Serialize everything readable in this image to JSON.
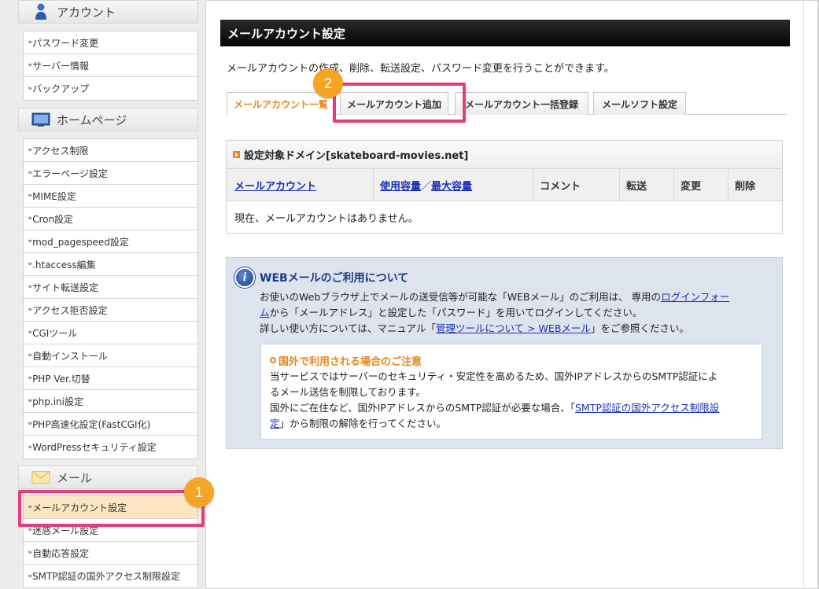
{
  "sidebar": {
    "sections": [
      {
        "heading": "アカウント",
        "icon": "user-icon",
        "items": [
          "パスワード変更",
          "サーバー情報",
          "バックアップ"
        ]
      },
      {
        "heading": "ホームページ",
        "icon": "monitor-icon",
        "items": [
          "アクセス制限",
          "エラーページ設定",
          "MIME設定",
          "Cron設定",
          "mod_pagespeed設定",
          ".htaccess編集",
          "サイト転送設定",
          "アクセス拒否設定",
          "CGIツール",
          "自動インストール",
          "PHP Ver.切替",
          "php.ini設定",
          "PHP高速化設定(FastCGI化)",
          "WordPressセキュリティ設定"
        ]
      },
      {
        "heading": "メール",
        "icon": "envelope-icon",
        "items": [
          "メールアカウント設定",
          "迷惑メール設定",
          "自動応答設定",
          "SMTP認証の国外アクセス制限設定"
        ]
      }
    ],
    "active_item": "メールアカウント設定"
  },
  "main": {
    "title": "メールアカウント設定",
    "description": "メールアカウントの作成、削除、転送設定、パスワード変更を行うことができます。",
    "tabs": [
      "メールアカウント一覧",
      "メールアカウント追加",
      "メールアカウント一括登録",
      "メールソフト設定"
    ],
    "active_tab": "メールアカウント一覧",
    "domain_heading": "設定対象ドメイン[skateboard-movies.net]",
    "table": {
      "col_account": "メールアカウント",
      "col_usage": "使用容量",
      "col_sep": "／",
      "col_max": "最大容量",
      "col_comment": "コメント",
      "col_forward": "転送",
      "col_change": "変更",
      "col_delete": "削除",
      "empty_message": "現在、メールアカウントはありません。"
    },
    "info": {
      "title": "WEBメールのご利用について",
      "line1_a": "お使いのWebブラウザ上でメールの送受信等が可能な「WEBメール」のご利用は、 専用の",
      "line1_link": "ログインフォー",
      "line2_link": "ム",
      "line2_b": "から「メールアドレス」と設定した「パスワード」を用いてログインしてください。",
      "line3_a": "詳しい使い方については、マニュアル「",
      "line3_link": "管理ツールについて > WEBメール",
      "line3_b": "」をご参照ください。",
      "notice_title": "国外で利用される場合のご注意",
      "notice_line1": "当サービスではサーバーのセキュリティ・安定性を高めるため、国外IPアドレスからのSMTP認証によ",
      "notice_line2": "るメール送信を制限しております。",
      "notice_line3_a": "国外にご在住など、国外IPアドレスからのSMTP認証が必要な場合、「",
      "notice_line3_link": "SMTP認証の国外アクセス制限設",
      "notice_line4_link": "定",
      "notice_line4_b": "」から制限の解除を行ってください。"
    }
  },
  "annotations": {
    "badge1": "1",
    "badge2": "2"
  },
  "colors": {
    "accent_orange": "#e8841a",
    "highlight_pink": "#e23d7e",
    "badge_orange": "#f3a523",
    "link_blue": "#1a2fb8",
    "title_bar": "#111111"
  }
}
